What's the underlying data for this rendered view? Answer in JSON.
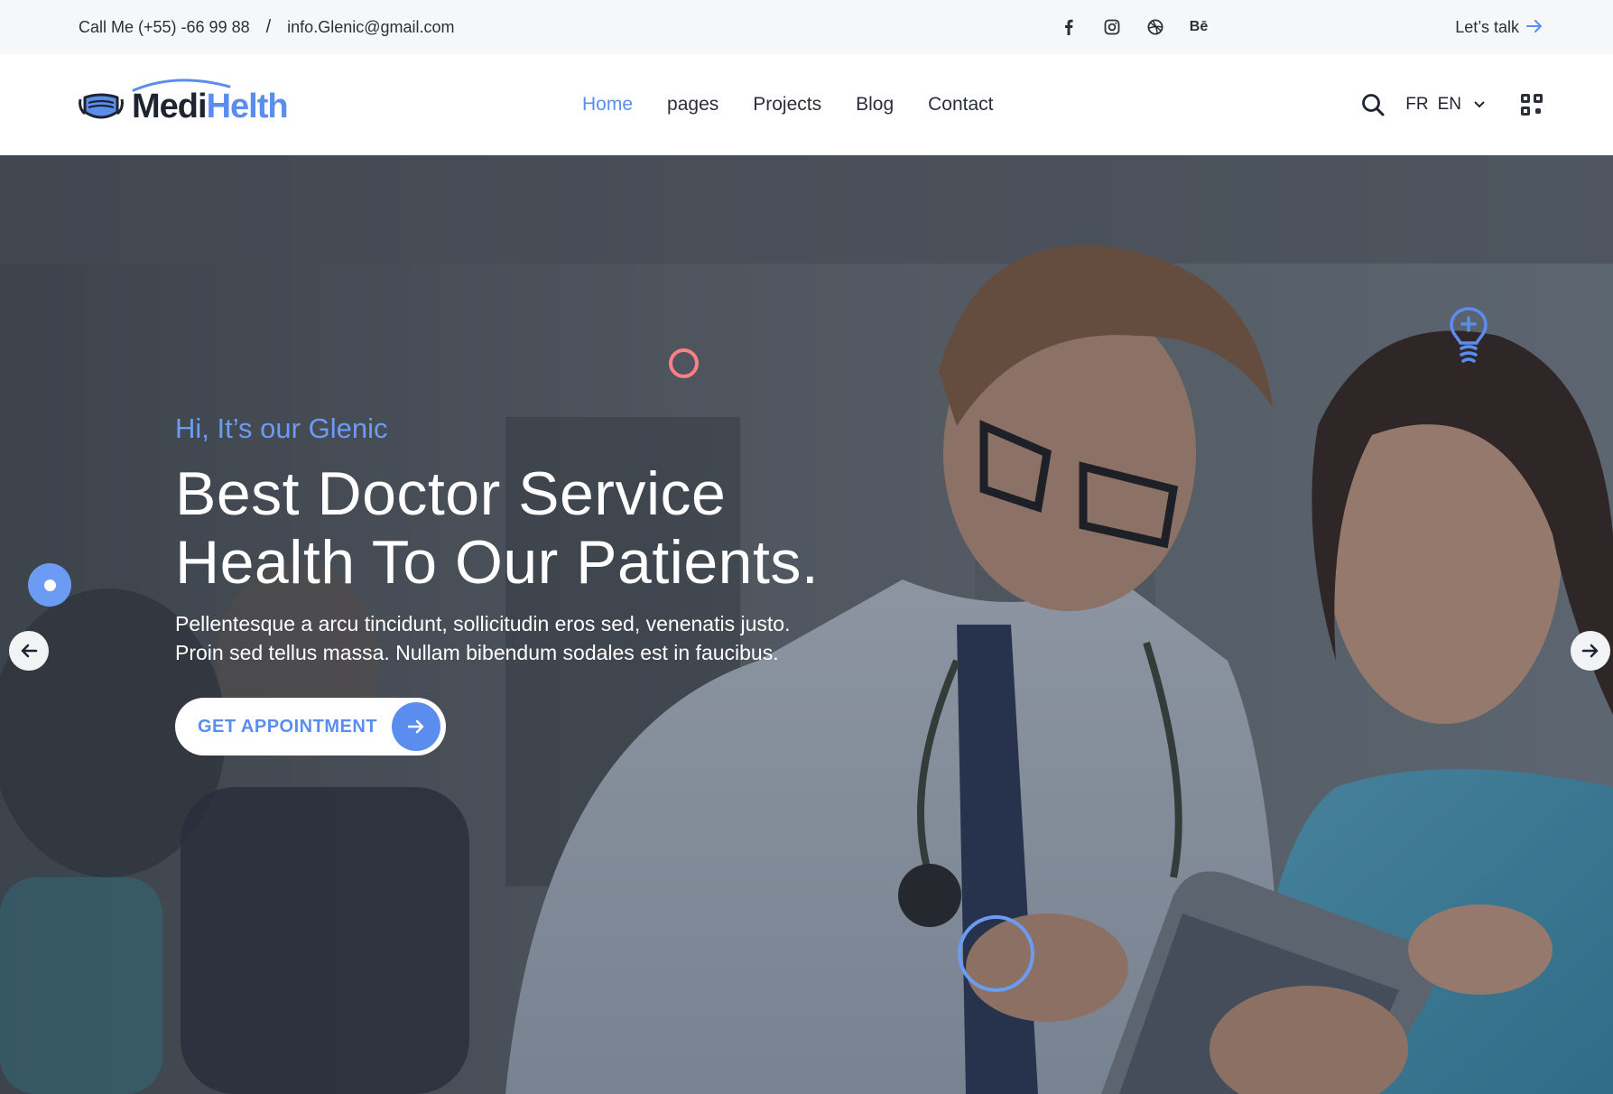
{
  "topbar": {
    "phone": "Call Me (+55) -66 99 88",
    "separator": "/",
    "email": "info.Glenic@gmail.com",
    "socials": [
      {
        "icon": "facebook-icon",
        "label": "f"
      },
      {
        "icon": "instagram-icon",
        "label": ""
      },
      {
        "icon": "dribbble-icon",
        "label": ""
      },
      {
        "icon": "behance-icon",
        "label": "Bē"
      }
    ],
    "cta_label": "Let’s talk",
    "cta_icon": "arrow-right-icon"
  },
  "header": {
    "logo_part1": "Medi",
    "logo_part2": "Helth",
    "nav": [
      {
        "label": "Home",
        "active": true
      },
      {
        "label": "pages",
        "active": false
      },
      {
        "label": "Projects",
        "active": false
      },
      {
        "label": "Blog",
        "active": false
      },
      {
        "label": "Contact",
        "active": false
      }
    ],
    "lang_options": [
      "FR",
      "EN"
    ],
    "lang_selected": "EN"
  },
  "hero": {
    "tagline": "Hi, It’s our Glenic",
    "title_line1": "Best Doctor Service",
    "title_line2": "Health To Our Patients.",
    "desc_line1": "Pellentesque a arcu tincidunt, sollicitudin eros sed, venenatis justo.",
    "desc_line2": "Proin sed tellus massa. Nullam bibendum sodales est in faucibus.",
    "cta_label": "GET APPOINTMENT"
  },
  "colors": {
    "accent": "#5b8def",
    "accent_light": "#6b9bf2",
    "ring_red": "#ff7f86",
    "topbar_bg": "#f6f7f8"
  }
}
